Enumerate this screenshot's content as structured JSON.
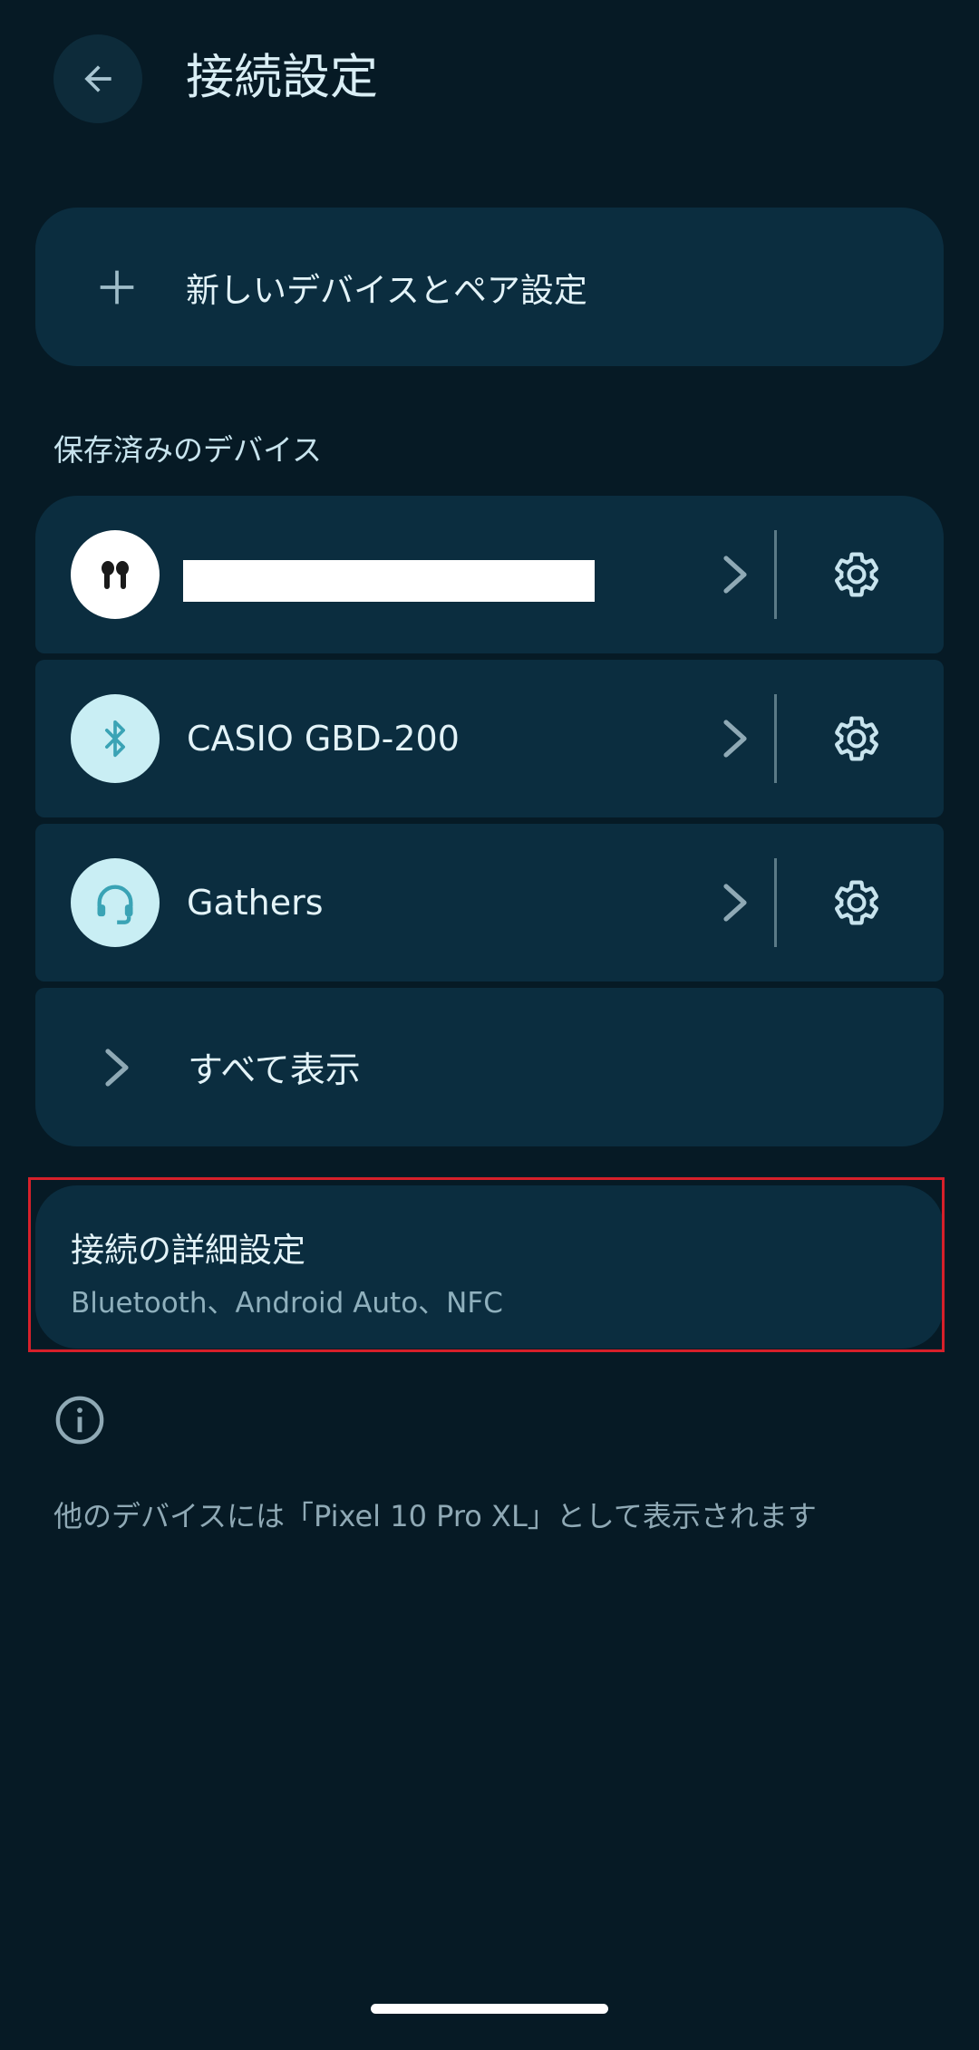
{
  "header": {
    "title": "接続設定",
    "back_icon": "arrow-back-icon"
  },
  "pair_new": {
    "label": "新しいデバイスとペア設定",
    "icon": "plus-icon"
  },
  "saved_devices": {
    "header": "保存済みのデバイス",
    "items": [
      {
        "name": "",
        "icon": "earbuds-icon",
        "name_redacted": true
      },
      {
        "name": "CASIO GBD-200",
        "icon": "bluetooth-icon"
      },
      {
        "name": "Gathers",
        "icon": "headset-icon"
      }
    ],
    "see_all_label": "すべて表示"
  },
  "advanced": {
    "title": "接続の詳細設定",
    "subtitle": "Bluetooth、Android Auto、NFC"
  },
  "footer": {
    "info_icon": "info-icon",
    "text": "他のデバイスには「Pixel 10 Pro XL」として表示されます"
  },
  "colors": {
    "background": "#061a25",
    "card": "#0b2d3f",
    "accent": "#3aa3b5",
    "highlight": "#d6202a"
  }
}
